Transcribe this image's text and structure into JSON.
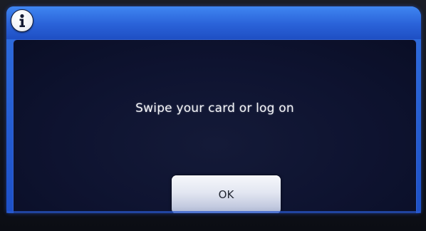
{
  "dialog": {
    "icon": "info-icon",
    "message": "Swipe your card or log on",
    "ok_label": "OK"
  },
  "colors": {
    "titlebar": "#2a62d8",
    "content_background": "#0e1330",
    "button_face": "#e2e6f1",
    "text": "#f3f4f8"
  }
}
